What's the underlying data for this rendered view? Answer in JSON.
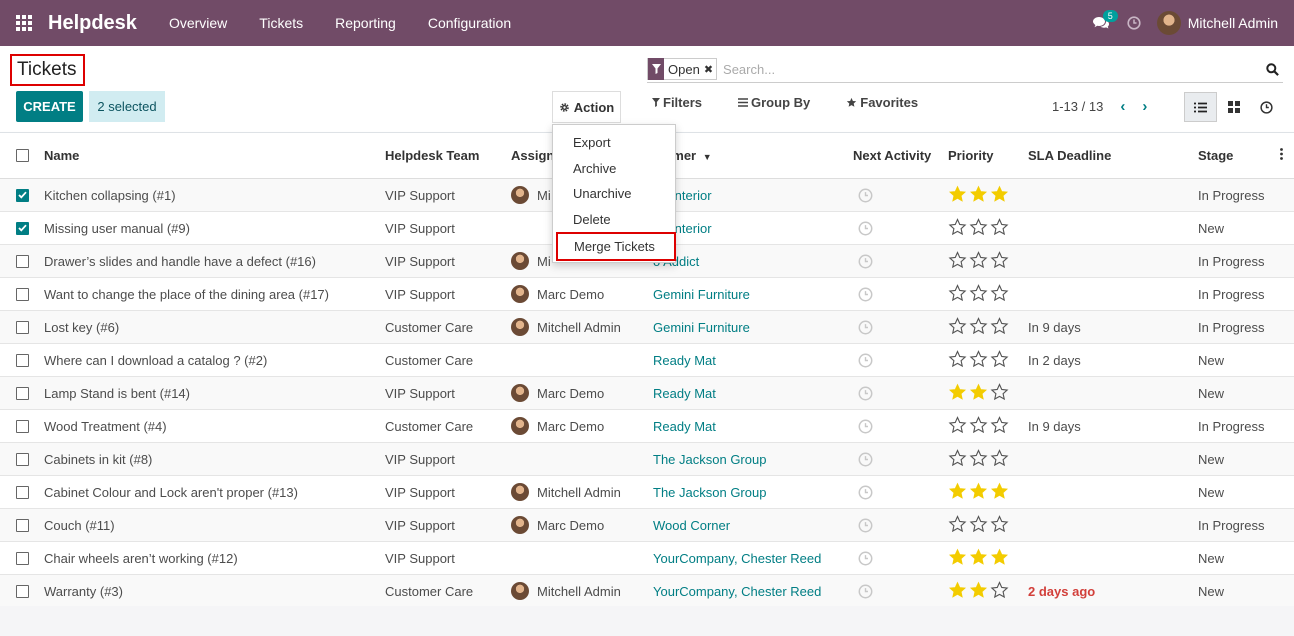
{
  "navbar": {
    "app_name": "Helpdesk",
    "menu": [
      "Overview",
      "Tickets",
      "Reporting",
      "Configuration"
    ],
    "chat_count": "5",
    "user_name": "Mitchell Admin",
    "color": "#714b67"
  },
  "control": {
    "breadcrumb": "Tickets",
    "create_label": "CREATE",
    "selected_label": "2 selected",
    "action_label": "Action",
    "facet_label": "Open",
    "search_placeholder": "Search...",
    "filters_label": "Filters",
    "group_by_label": "Group By",
    "favorites_label": "Favorites",
    "pager": "1-13 / 13"
  },
  "action_menu": [
    "Export",
    "Archive",
    "Unarchive",
    "Delete",
    "Merge Tickets"
  ],
  "columns": {
    "name": "Name",
    "team": "Helpdesk Team",
    "assigned": "Assign",
    "customer": "tomer",
    "next_activity": "Next Activity",
    "priority": "Priority",
    "sla": "SLA Deadline",
    "stage": "Stage"
  },
  "rows": [
    {
      "checked": true,
      "name": "Kitchen collapsing (#1)",
      "team": "VIP Support",
      "assigned": "Mi",
      "avatar": true,
      "customer": "ire Interior",
      "priority": 3,
      "sla": "",
      "stage": "In Progress"
    },
    {
      "checked": true,
      "name": "Missing user manual (#9)",
      "team": "VIP Support",
      "assigned": "",
      "avatar": false,
      "customer": "ire Interior",
      "priority": 0,
      "sla": "",
      "stage": "New"
    },
    {
      "checked": false,
      "name": "Drawer’s slides and handle have a defect (#16)",
      "team": "VIP Support",
      "assigned": "Mi",
      "avatar": true,
      "customer": "o Addict",
      "priority": 0,
      "sla": "",
      "stage": "In Progress"
    },
    {
      "checked": false,
      "name": "Want to change the place of the dining area (#17)",
      "team": "VIP Support",
      "assigned": "Marc Demo",
      "avatar": true,
      "customer": "Gemini Furniture",
      "priority": 0,
      "sla": "",
      "stage": "In Progress"
    },
    {
      "checked": false,
      "name": "Lost key (#6)",
      "team": "Customer Care",
      "assigned": "Mitchell Admin",
      "avatar": true,
      "customer": "Gemini Furniture",
      "priority": 0,
      "sla": "In 9 days",
      "stage": "In Progress"
    },
    {
      "checked": false,
      "name": "Where can I download a catalog ? (#2)",
      "team": "Customer Care",
      "assigned": "",
      "avatar": false,
      "customer": "Ready Mat",
      "priority": 0,
      "sla": "In 2 days",
      "stage": "New"
    },
    {
      "checked": false,
      "name": "Lamp Stand is bent (#14)",
      "team": "VIP Support",
      "assigned": "Marc Demo",
      "avatar": true,
      "customer": "Ready Mat",
      "priority": 2,
      "sla": "",
      "stage": "New"
    },
    {
      "checked": false,
      "name": "Wood Treatment (#4)",
      "team": "Customer Care",
      "assigned": "Marc Demo",
      "avatar": true,
      "customer": "Ready Mat",
      "priority": 0,
      "sla": "In 9 days",
      "stage": "In Progress"
    },
    {
      "checked": false,
      "name": "Cabinets in kit (#8)",
      "team": "VIP Support",
      "assigned": "",
      "avatar": false,
      "customer": "The Jackson Group",
      "priority": 0,
      "sla": "",
      "stage": "New"
    },
    {
      "checked": false,
      "name": "Cabinet Colour and Lock aren't proper (#13)",
      "team": "VIP Support",
      "assigned": "Mitchell Admin",
      "avatar": true,
      "customer": "The Jackson Group",
      "priority": 3,
      "sla": "",
      "stage": "New"
    },
    {
      "checked": false,
      "name": "Couch (#11)",
      "team": "VIP Support",
      "assigned": "Marc Demo",
      "avatar": true,
      "customer": "Wood Corner",
      "priority": 0,
      "sla": "",
      "stage": "In Progress"
    },
    {
      "checked": false,
      "name": "Chair wheels aren’t working (#12)",
      "team": "VIP Support",
      "assigned": "",
      "avatar": false,
      "customer": "YourCompany, Chester Reed",
      "priority": 3,
      "sla": "",
      "stage": "New"
    },
    {
      "checked": false,
      "name": "Warranty (#3)",
      "team": "Customer Care",
      "assigned": "Mitchell Admin",
      "avatar": true,
      "customer": "YourCompany, Chester Reed",
      "priority": 2,
      "sla": "2 days ago",
      "sla_late": true,
      "stage": "New"
    }
  ],
  "colors": {
    "accent": "#017e84",
    "star": "#f3cc00",
    "late": "#d23f3a",
    "highlight": "#dd0000"
  }
}
